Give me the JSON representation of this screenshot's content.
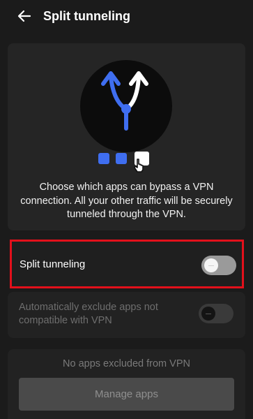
{
  "header": {
    "back_icon": "arrow-left-icon",
    "title": "Split tunneling"
  },
  "hero": {
    "illustration_icon": "split-arrows-icon",
    "apps_icon": "app-squares-with-hand-pointer-icon",
    "description": "Choose which apps can bypass a VPN connection. All your other traffic will be securely tunneled through the VPN."
  },
  "split_tunneling": {
    "label": "Split tunneling",
    "enabled": false
  },
  "auto_exclude": {
    "label": "Automatically exclude apps not compatible with VPN",
    "enabled": false
  },
  "excluded_apps": {
    "empty_text": "No apps excluded from VPN",
    "manage_label": "Manage apps"
  },
  "colors": {
    "background": "#1b1b1b",
    "card": "#252525",
    "accent_blue": "#3f6ef0",
    "highlight_red": "#e3101b"
  }
}
